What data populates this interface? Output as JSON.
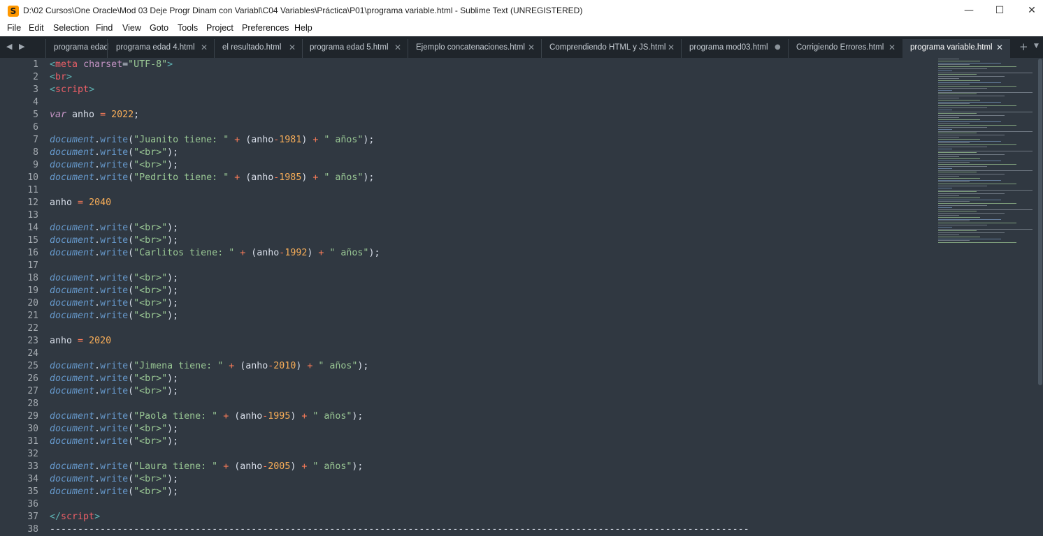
{
  "window": {
    "title": "D:\\02 Cursos\\One Oracle\\Mod 03 Deje Progr Dinam con Variabl\\C04 Variables\\Práctica\\P01\\programa variable.html - Sublime Text (UNREGISTERED)",
    "app_icon": "S",
    "minimize": "—",
    "maximize": "☐",
    "close": "✕"
  },
  "menu": [
    "File",
    "Edit",
    "Selection",
    "Find",
    "View",
    "Goto",
    "Tools",
    "Project",
    "Preferences",
    "Help"
  ],
  "tabs": [
    {
      "label": "programa edad",
      "close": ""
    },
    {
      "label": "programa edad 4.html",
      "close": "✕"
    },
    {
      "label": "el resultado.html",
      "close": "✕"
    },
    {
      "label": "programa edad 5.html",
      "close": "✕"
    },
    {
      "label": "Ejemplo concatenaciones.html",
      "close": "✕"
    },
    {
      "label": "Comprendiendo HTML y JS.html",
      "close": "✕"
    },
    {
      "label": "programa mod03.html",
      "close": "●"
    },
    {
      "label": "Corrigiendo Errores.html",
      "close": "✕"
    },
    {
      "label": "programa variable.html",
      "close": "✕"
    }
  ],
  "tabbar": {
    "nav_arrows": "◀ ▶",
    "new_tab": "+",
    "tab_list": "▼"
  },
  "editor": {
    "line_numbers": [
      "1",
      "2",
      "3",
      "4",
      "5",
      "6",
      "7",
      "8",
      "9",
      "10",
      "11",
      "12",
      "13",
      "14",
      "15",
      "16",
      "17",
      "18",
      "19",
      "20",
      "21",
      "22",
      "23",
      "24",
      "25",
      "26",
      "27",
      "28",
      "29",
      "30",
      "31",
      "32",
      "33",
      "34",
      "35",
      "36",
      "37",
      "38"
    ],
    "lines": [
      [
        [
          "tg",
          "<"
        ],
        [
          "tn",
          "meta"
        ],
        [
          "pl",
          " "
        ],
        [
          "at",
          "charset"
        ],
        [
          "pl",
          "="
        ],
        [
          "st",
          "\"UTF-8\""
        ],
        [
          "tg",
          ">"
        ]
      ],
      [
        [
          "tg",
          "<"
        ],
        [
          "tn",
          "br"
        ],
        [
          "tg",
          ">"
        ]
      ],
      [
        [
          "tg",
          "<"
        ],
        [
          "tn",
          "script"
        ],
        [
          "tg",
          ">"
        ]
      ],
      [],
      [
        [
          "kw",
          "var"
        ],
        [
          "pl",
          " anho "
        ],
        [
          "op",
          "="
        ],
        [
          "pl",
          " "
        ],
        [
          "nu",
          "2022"
        ],
        [
          "pl",
          ";"
        ]
      ],
      [],
      [
        [
          "ob",
          "document"
        ],
        [
          "pl",
          "."
        ],
        [
          "fn",
          "write"
        ],
        [
          "pl",
          "("
        ],
        [
          "st",
          "\"Juanito tiene: \""
        ],
        [
          "pl",
          " "
        ],
        [
          "op",
          "+"
        ],
        [
          "pl",
          " (anho"
        ],
        [
          "op",
          "-"
        ],
        [
          "nu",
          "1981"
        ],
        [
          "pl",
          ") "
        ],
        [
          "op",
          "+"
        ],
        [
          "pl",
          " "
        ],
        [
          "st",
          "\" años\""
        ],
        [
          "pl",
          ");"
        ]
      ],
      [
        [
          "ob",
          "document"
        ],
        [
          "pl",
          "."
        ],
        [
          "fn",
          "write"
        ],
        [
          "pl",
          "("
        ],
        [
          "st",
          "\"<br>\""
        ],
        [
          "pl",
          ");"
        ]
      ],
      [
        [
          "ob",
          "document"
        ],
        [
          "pl",
          "."
        ],
        [
          "fn",
          "write"
        ],
        [
          "pl",
          "("
        ],
        [
          "st",
          "\"<br>\""
        ],
        [
          "pl",
          ");"
        ]
      ],
      [
        [
          "ob",
          "document"
        ],
        [
          "pl",
          "."
        ],
        [
          "fn",
          "write"
        ],
        [
          "pl",
          "("
        ],
        [
          "st",
          "\"Pedrito tiene: \""
        ],
        [
          "pl",
          " "
        ],
        [
          "op",
          "+"
        ],
        [
          "pl",
          " (anho"
        ],
        [
          "op",
          "-"
        ],
        [
          "nu",
          "1985"
        ],
        [
          "pl",
          ") "
        ],
        [
          "op",
          "+"
        ],
        [
          "pl",
          " "
        ],
        [
          "st",
          "\" años\""
        ],
        [
          "pl",
          ");"
        ]
      ],
      [],
      [
        [
          "pl",
          "anho "
        ],
        [
          "op",
          "="
        ],
        [
          "pl",
          " "
        ],
        [
          "nu",
          "2040"
        ]
      ],
      [],
      [
        [
          "ob",
          "document"
        ],
        [
          "pl",
          "."
        ],
        [
          "fn",
          "write"
        ],
        [
          "pl",
          "("
        ],
        [
          "st",
          "\"<br>\""
        ],
        [
          "pl",
          ");"
        ]
      ],
      [
        [
          "ob",
          "document"
        ],
        [
          "pl",
          "."
        ],
        [
          "fn",
          "write"
        ],
        [
          "pl",
          "("
        ],
        [
          "st",
          "\"<br>\""
        ],
        [
          "pl",
          ");"
        ]
      ],
      [
        [
          "ob",
          "document"
        ],
        [
          "pl",
          "."
        ],
        [
          "fn",
          "write"
        ],
        [
          "pl",
          "("
        ],
        [
          "st",
          "\"Carlitos tiene: \""
        ],
        [
          "pl",
          " "
        ],
        [
          "op",
          "+"
        ],
        [
          "pl",
          " (anho"
        ],
        [
          "op",
          "-"
        ],
        [
          "nu",
          "1992"
        ],
        [
          "pl",
          ") "
        ],
        [
          "op",
          "+"
        ],
        [
          "pl",
          " "
        ],
        [
          "st",
          "\" años\""
        ],
        [
          "pl",
          ");"
        ]
      ],
      [],
      [
        [
          "ob",
          "document"
        ],
        [
          "pl",
          "."
        ],
        [
          "fn",
          "write"
        ],
        [
          "pl",
          "("
        ],
        [
          "st",
          "\"<br>\""
        ],
        [
          "pl",
          ");"
        ]
      ],
      [
        [
          "ob",
          "document"
        ],
        [
          "pl",
          "."
        ],
        [
          "fn",
          "write"
        ],
        [
          "pl",
          "("
        ],
        [
          "st",
          "\"<br>\""
        ],
        [
          "pl",
          ");"
        ]
      ],
      [
        [
          "ob",
          "document"
        ],
        [
          "pl",
          "."
        ],
        [
          "fn",
          "write"
        ],
        [
          "pl",
          "("
        ],
        [
          "st",
          "\"<br>\""
        ],
        [
          "pl",
          ");"
        ]
      ],
      [
        [
          "ob",
          "document"
        ],
        [
          "pl",
          "."
        ],
        [
          "fn",
          "write"
        ],
        [
          "pl",
          "("
        ],
        [
          "st",
          "\"<br>\""
        ],
        [
          "pl",
          ");"
        ]
      ],
      [],
      [
        [
          "pl",
          "anho "
        ],
        [
          "op",
          "="
        ],
        [
          "pl",
          " "
        ],
        [
          "nu",
          "2020"
        ]
      ],
      [],
      [
        [
          "ob",
          "document"
        ],
        [
          "pl",
          "."
        ],
        [
          "fn",
          "write"
        ],
        [
          "pl",
          "("
        ],
        [
          "st",
          "\"Jimena tiene: \""
        ],
        [
          "pl",
          " "
        ],
        [
          "op",
          "+"
        ],
        [
          "pl",
          " (anho"
        ],
        [
          "op",
          "-"
        ],
        [
          "nu",
          "2010"
        ],
        [
          "pl",
          ") "
        ],
        [
          "op",
          "+"
        ],
        [
          "pl",
          " "
        ],
        [
          "st",
          "\" años\""
        ],
        [
          "pl",
          ");"
        ]
      ],
      [
        [
          "ob",
          "document"
        ],
        [
          "pl",
          "."
        ],
        [
          "fn",
          "write"
        ],
        [
          "pl",
          "("
        ],
        [
          "st",
          "\"<br>\""
        ],
        [
          "pl",
          ");"
        ]
      ],
      [
        [
          "ob",
          "document"
        ],
        [
          "pl",
          "."
        ],
        [
          "fn",
          "write"
        ],
        [
          "pl",
          "("
        ],
        [
          "st",
          "\"<br>\""
        ],
        [
          "pl",
          ");"
        ]
      ],
      [],
      [
        [
          "ob",
          "document"
        ],
        [
          "pl",
          "."
        ],
        [
          "fn",
          "write"
        ],
        [
          "pl",
          "("
        ],
        [
          "st",
          "\"Paola tiene: \""
        ],
        [
          "pl",
          " "
        ],
        [
          "op",
          "+"
        ],
        [
          "pl",
          " (anho"
        ],
        [
          "op",
          "-"
        ],
        [
          "nu",
          "1995"
        ],
        [
          "pl",
          ") "
        ],
        [
          "op",
          "+"
        ],
        [
          "pl",
          " "
        ],
        [
          "st",
          "\" años\""
        ],
        [
          "pl",
          ");"
        ]
      ],
      [
        [
          "ob",
          "document"
        ],
        [
          "pl",
          "."
        ],
        [
          "fn",
          "write"
        ],
        [
          "pl",
          "("
        ],
        [
          "st",
          "\"<br>\""
        ],
        [
          "pl",
          ");"
        ]
      ],
      [
        [
          "ob",
          "document"
        ],
        [
          "pl",
          "."
        ],
        [
          "fn",
          "write"
        ],
        [
          "pl",
          "("
        ],
        [
          "st",
          "\"<br>\""
        ],
        [
          "pl",
          ");"
        ]
      ],
      [],
      [
        [
          "ob",
          "document"
        ],
        [
          "pl",
          "."
        ],
        [
          "fn",
          "write"
        ],
        [
          "pl",
          "("
        ],
        [
          "st",
          "\"Laura tiene: \""
        ],
        [
          "pl",
          " "
        ],
        [
          "op",
          "+"
        ],
        [
          "pl",
          " (anho"
        ],
        [
          "op",
          "-"
        ],
        [
          "nu",
          "2005"
        ],
        [
          "pl",
          ") "
        ],
        [
          "op",
          "+"
        ],
        [
          "pl",
          " "
        ],
        [
          "st",
          "\" años\""
        ],
        [
          "pl",
          ");"
        ]
      ],
      [
        [
          "ob",
          "document"
        ],
        [
          "pl",
          "."
        ],
        [
          "fn",
          "write"
        ],
        [
          "pl",
          "("
        ],
        [
          "st",
          "\"<br>\""
        ],
        [
          "pl",
          ");"
        ]
      ],
      [
        [
          "ob",
          "document"
        ],
        [
          "pl",
          "."
        ],
        [
          "fn",
          "write"
        ],
        [
          "pl",
          "("
        ],
        [
          "st",
          "\"<br>\""
        ],
        [
          "pl",
          ");"
        ]
      ],
      [],
      [
        [
          "tg",
          "</"
        ],
        [
          "tn",
          "script"
        ],
        [
          "tg",
          ">"
        ]
      ],
      [
        [
          "pl",
          "-----------------------------------------------------------------------------------------------------------------------------"
        ]
      ]
    ]
  }
}
